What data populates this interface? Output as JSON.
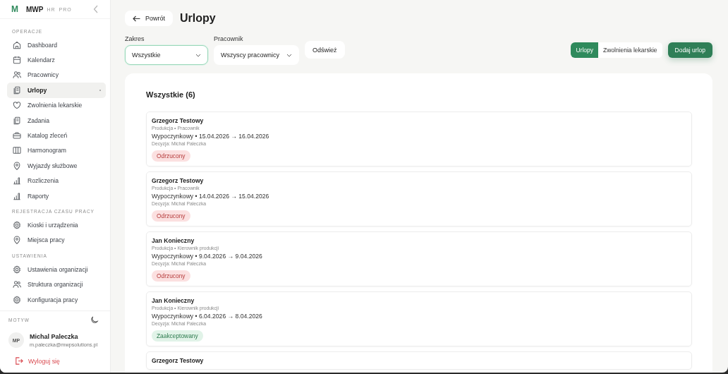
{
  "sidebar": {
    "logo": "M",
    "brand": "MWP",
    "brand_tag": "HR",
    "brand_edition": "PRO",
    "sections": [
      {
        "title": "OPERACJE",
        "items": [
          {
            "label": "Dashboard",
            "selected": false
          },
          {
            "label": "Kalendarz",
            "selected": false
          },
          {
            "label": "Pracownicy",
            "selected": false
          },
          {
            "label": "Urlopy",
            "selected": true
          },
          {
            "label": "Zwolnienia lekarskie",
            "selected": false
          },
          {
            "label": "Zadania",
            "selected": false
          },
          {
            "label": "Katalog zleceń",
            "selected": false
          },
          {
            "label": "Harmonogram",
            "selected": false
          },
          {
            "label": "Wyjazdy służbowe",
            "selected": false
          },
          {
            "label": "Rozliczenia",
            "selected": false
          },
          {
            "label": "Raporty",
            "selected": false
          }
        ]
      },
      {
        "title": "REJESTRACJA CZASU PRACY",
        "items": [
          {
            "label": "Kioski i urządzenia",
            "selected": false
          },
          {
            "label": "Miejsca pracy",
            "selected": false
          }
        ]
      },
      {
        "title": "USTAWIENIA",
        "items": [
          {
            "label": "Ustawienia organizacji",
            "selected": false
          },
          {
            "label": "Struktura organizacji",
            "selected": false
          },
          {
            "label": "Konfiguracja pracy",
            "selected": false
          }
        ]
      }
    ],
    "theme_label": "MOTYW",
    "user": {
      "initials": "MP",
      "name": "Michal Paleczka",
      "email": "m.paleczka@mwpsolutions.pl"
    },
    "logout": "Wyloguj się"
  },
  "header": {
    "back": "Powrót",
    "title": "Urlopy"
  },
  "filters": [
    {
      "label": "Zakres",
      "value": "Wszystkie",
      "focused": true
    },
    {
      "label": "Pracownik",
      "value": "Wszyscy pracownicy",
      "focused": false
    }
  ],
  "refresh": "Odśwież",
  "view_tabs": [
    {
      "label": "Urlopy",
      "selected": true
    },
    {
      "label": "Zwolnienia lekarskie",
      "selected": false
    }
  ],
  "add_button": "Dodaj urlop",
  "list": {
    "title": "Wszystkie (6)",
    "items": [
      {
        "name": "Grzegorz Testowy",
        "meta": "Produkcja • Pracownik",
        "period": "Wypoczynkowy • 15.04.2026 → 16.04.2026",
        "decision": "Decyzja: Michal Paleczka",
        "status": "Odrzucony",
        "kind": "rejected"
      },
      {
        "name": "Grzegorz Testowy",
        "meta": "Produkcja • Pracownik",
        "period": "Wypoczynkowy • 14.04.2026 → 15.04.2026",
        "decision": "Decyzja: Michal Paleczka",
        "status": "Odrzucony",
        "kind": "rejected"
      },
      {
        "name": "Jan Konieczny",
        "meta": "Produkcja • Kierownik produkcji",
        "period": "Wypoczynkowy • 9.04.2026 → 9.04.2026",
        "decision": "Decyzja: Michal Paleczka",
        "status": "Odrzucony",
        "kind": "rejected"
      },
      {
        "name": "Jan Konieczny",
        "meta": "Produkcja • Kierownik produkcji",
        "period": "Wypoczynkowy • 6.04.2026 → 8.04.2026",
        "decision": "Decyzja: Michal Paleczka",
        "status": "Zaakceptowany",
        "kind": "accepted"
      },
      {
        "name": "Grzegorz Testowy"
      }
    ]
  }
}
